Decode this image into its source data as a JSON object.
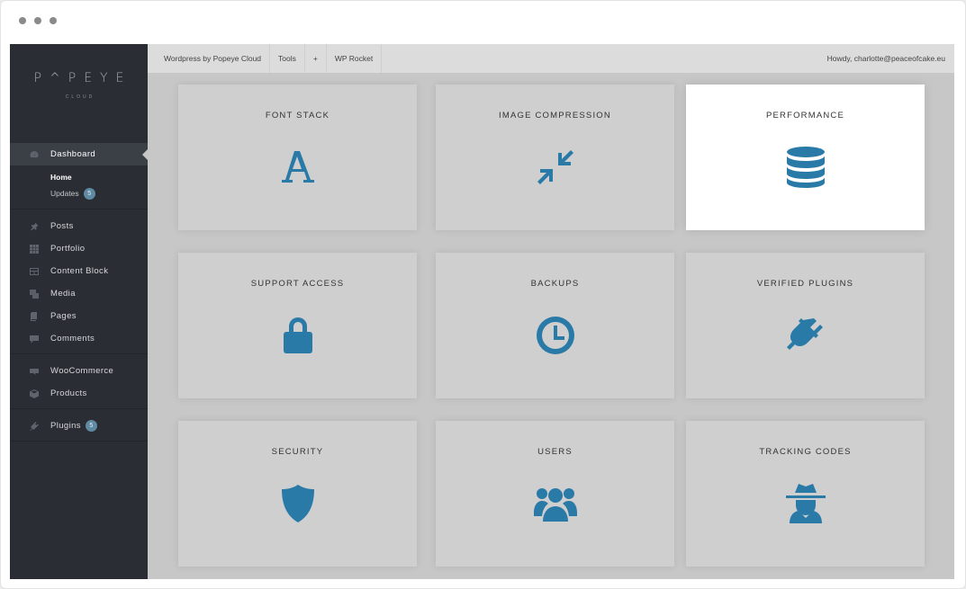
{
  "sidebar": {
    "logo": "PОPEYE",
    "logo_sub": "CLOUD",
    "dashboard": "Dashboard",
    "home": "Home",
    "updates": "Updates",
    "updates_count": "5",
    "items": [
      "Posts",
      "Portfolio",
      "Content Block",
      "Media",
      "Pages",
      "Comments"
    ],
    "items2": [
      "WooCommerce",
      "Products"
    ],
    "plugins": "Plugins",
    "plugins_count": "5"
  },
  "topbar": {
    "site": "Wordpress by Popeye Cloud",
    "tools": "Tools",
    "plus": "+",
    "rocket": "WP Rocket",
    "howdy": "Howdy, charlotte@peaceofcake.eu"
  },
  "cards": [
    {
      "title": "FONT STACK",
      "icon": "font-icon"
    },
    {
      "title": "IMAGE COMPRESSION",
      "icon": "compress-icon"
    },
    {
      "title": "PERFORMANCE",
      "icon": "database-icon"
    },
    {
      "title": "SUPPORT ACCESS",
      "icon": "lock-icon"
    },
    {
      "title": "BACKUPS",
      "icon": "clock-icon"
    },
    {
      "title": "VERIFIED PLUGINS",
      "icon": "plug-icon"
    },
    {
      "title": "SECURITY",
      "icon": "shield-icon"
    },
    {
      "title": "USERS",
      "icon": "users-icon"
    },
    {
      "title": "TRACKING CODES",
      "icon": "spy-icon"
    }
  ],
  "colors": {
    "accent": "#2a7aa8",
    "sidebar": "#2a2d33",
    "card": "#cfcfcf",
    "card_active": "#ffffff"
  }
}
